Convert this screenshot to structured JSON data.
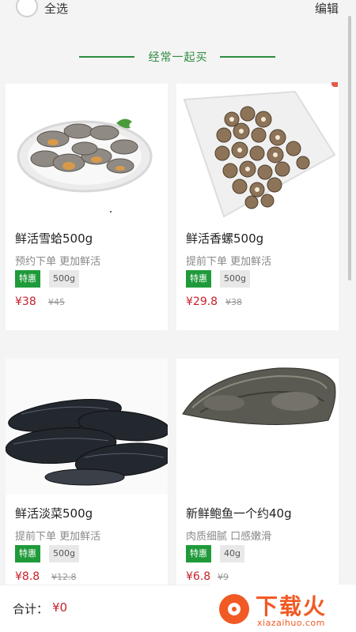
{
  "top": {
    "select_all": "全选",
    "edit": "编辑"
  },
  "section": {
    "title": "经常一起买"
  },
  "products": [
    {
      "name": "鲜活雪蛤500g",
      "desc": "预约下单 更加鲜活",
      "tag": "特惠",
      "weight": "500g",
      "price": "¥38",
      "old_price": "¥45",
      "image": "clams-on-plate-image"
    },
    {
      "name": "鲜活香螺500g",
      "desc": "提前下单 更加鲜活",
      "tag": "特惠",
      "weight": "500g",
      "price": "¥29.8",
      "old_price": "¥38",
      "image": "sea-snails-on-dish-image"
    },
    {
      "name": "鲜活淡菜500g",
      "desc": "提前下单 更加鲜活",
      "tag": "特惠",
      "weight": "500g",
      "price": "¥8.8",
      "old_price": "¥12.8",
      "image": "mussels-image"
    },
    {
      "name": "新鲜鲍鱼一个约40g",
      "desc": "肉质细腻 口感嫩滑",
      "tag": "特惠",
      "weight": "40g",
      "price": "¥6.8",
      "old_price": "¥9",
      "image": "abalone-image"
    }
  ],
  "footer": {
    "total_label": "合计：",
    "total_value": "¥0"
  },
  "watermark": {
    "brand": "下载火",
    "site": "xiazaihuo.com"
  },
  "colors": {
    "accent_green": "#2e8b3e",
    "tag_green": "#1f9a3a",
    "price_red": "#c8202a",
    "logo_orange": "#f15a24"
  }
}
